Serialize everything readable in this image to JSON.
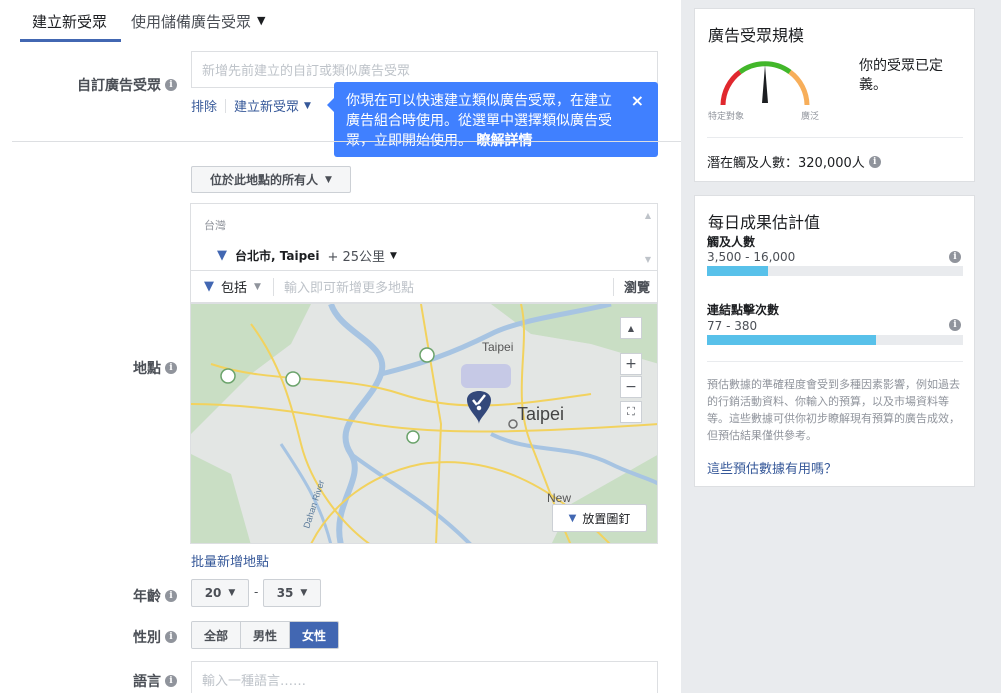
{
  "tabs": [
    {
      "label": "建立新受眾"
    },
    {
      "label": "使用儲備廣告受眾"
    }
  ],
  "custom_audience": {
    "label": "自訂廣告受眾",
    "placeholder": "新增先前建立的自訂或類似廣告受眾",
    "exclude_link": "排除",
    "create_link": "建立新受眾"
  },
  "tooltip": {
    "text": "你現在可以快速建立類似廣告受眾，在建立廣告組合時使用。從選單中選擇類似廣告受眾，立即開始使用。",
    "learn_more": "瞭解詳情",
    "close": "×"
  },
  "location": {
    "label": "地點",
    "audience_type": "位於此地點的所有人",
    "country": "台灣",
    "city": "台北市, Taipei",
    "radius": "+ 25公里",
    "include": "包括",
    "input_placeholder": "輸入即可新增更多地點",
    "browse": "瀏覽",
    "bulk_add": "批量新增地點",
    "drop_pin": "放置圖釘",
    "map_labels": {
      "taipei_small": "Taipei",
      "taipei_big": "Taipei",
      "new": "New",
      "river": "Dahan River"
    }
  },
  "age": {
    "label": "年齡",
    "min": "20",
    "sep": "-",
    "max": "35"
  },
  "gender": {
    "label": "性別",
    "options": [
      "全部",
      "男性",
      "女性"
    ],
    "selected": "女性"
  },
  "language": {
    "label": "語言",
    "placeholder": "輸入一種語言……"
  },
  "audience_size": {
    "title": "廣告受眾規模",
    "specific": "特定對象",
    "broad": "廣泛",
    "status": "你的受眾已定義。",
    "potential_reach": "潛在觸及人數：320,000人"
  },
  "daily_results": {
    "title": "每日成果估計值",
    "reach_label": "觸及人數",
    "reach_value": "3,500 - 16,000",
    "reach_fill": 0.24,
    "clicks_label": "連結點擊次數",
    "clicks_value": "77 - 380",
    "clicks_fill": 0.66,
    "disclaimer": "預估數據的準確程度會受到多種因素影響，例如過去的行銷活動資料、你輸入的預算，以及市場資料等等。這些數據可供你初步瞭解現有預算的廣告成效，但預估結果僅供參考。",
    "helpful_link": "這些預估數據有用嗎？"
  },
  "colors": {
    "accent": "#4267b2",
    "tooltip": "#4080ff",
    "bar": "#58c1ea"
  }
}
